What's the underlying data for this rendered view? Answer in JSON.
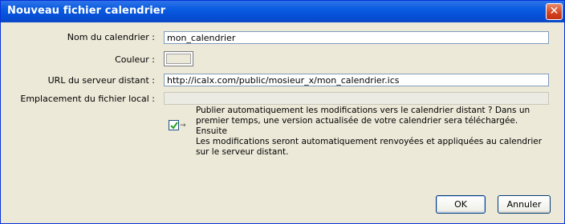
{
  "dialog": {
    "title": "Nouveau fichier calendrier",
    "close_symbol": "✕"
  },
  "fields": {
    "name_label": "Nom du calendrier :",
    "name_value": "mon_calendrier",
    "color_label": "Couleur :",
    "url_label": "URL du serveur distant :",
    "url_value": "http://icalx.com/public/mosieur_x/mon_calendrier.ics",
    "local_label": "Emplacement du fichier local :",
    "local_value": ""
  },
  "publish": {
    "checked": true,
    "lines": [
      "Publier automatiquement les modifications vers le calendrier distant ? Dans un",
      "premier temps, une version actualisée de votre calendrier sera téléchargée. Ensuite",
      "Les modifications seront automatiquement renvoyées et appliquées au calendrier",
      "sur le serveur distant."
    ]
  },
  "buttons": {
    "ok": "OK",
    "cancel": "Annuler"
  },
  "colors": {
    "titlebar": "#0a5be0",
    "dialog_bg": "#ece9d8",
    "close": "#d3431f",
    "checkmark": "#21a121"
  },
  "icons": {
    "close": "close-icon",
    "check": "checkmark-icon",
    "arrow": "arrow-right-icon"
  }
}
